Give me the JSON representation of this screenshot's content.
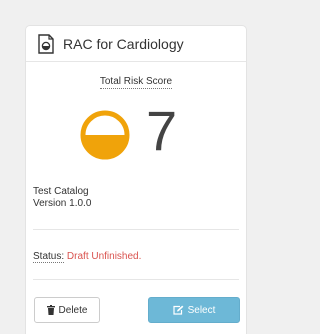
{
  "card": {
    "title": "RAC for Cardiology",
    "score_label": "Total Risk Score",
    "score_value": "7",
    "gauge_fill_fraction": 0.5,
    "gauge_color": "#f0a30a",
    "catalog_name": "Test Catalog",
    "version": "Version 1.0.0",
    "status_label": "Status:",
    "status_value": "Draft Unfinished.",
    "status_color": "#d9534f"
  },
  "buttons": {
    "delete_label": "Delete",
    "select_label": "Select"
  },
  "icons": {
    "header": "document-icon",
    "delete": "trash-icon",
    "select": "edit-icon"
  }
}
